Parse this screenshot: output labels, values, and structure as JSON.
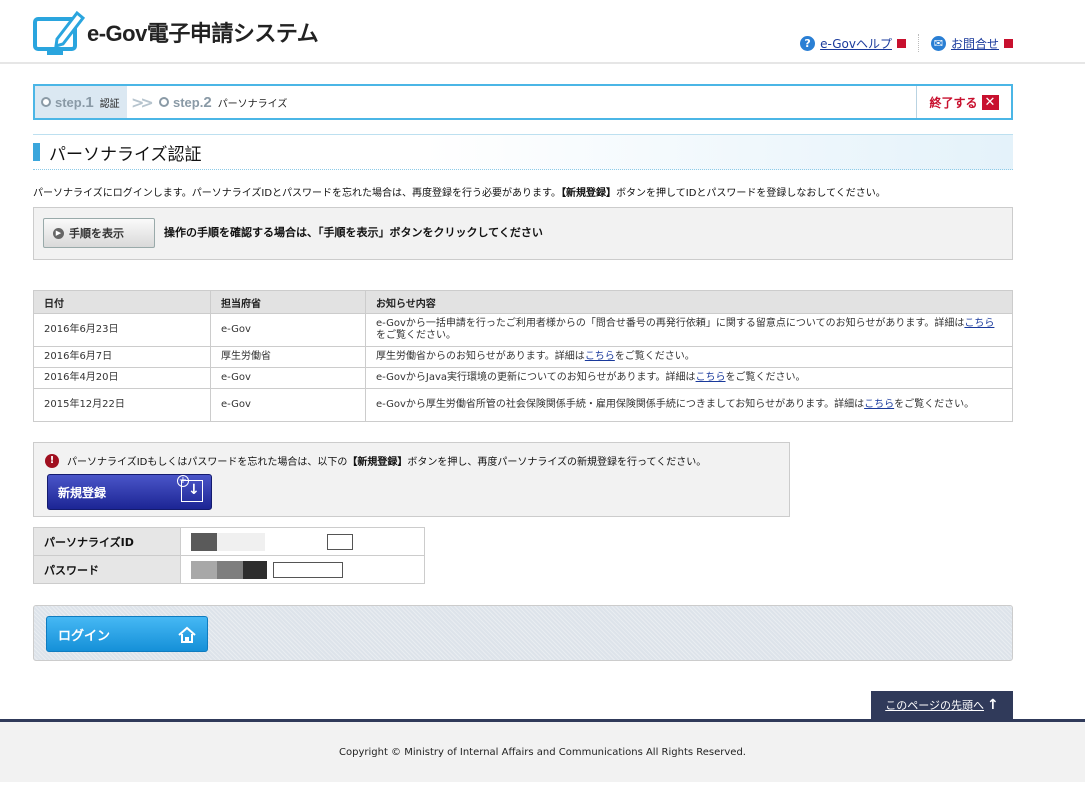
{
  "header": {
    "logo_text": "e-Gov電子申請システム",
    "help_label": "e-Govヘルプ",
    "contact_label": "お問合せ"
  },
  "steps": {
    "step1_prefix": "step.",
    "step1_num": "1",
    "step1_name": "認証",
    "step2_prefix": "step.",
    "step2_num": "2",
    "step2_name": "パーソナライズ",
    "finish_label": "終了する"
  },
  "section": {
    "title": "パーソナライズ認証",
    "intro_before": "パーソナライズにログインします。パーソナライズIDとパスワードを忘れた場合は、再度登録を行う必要があります。",
    "intro_bold": "【新規登録】",
    "intro_after": "ボタンを押してIDとパスワードを登録しなおしてください。"
  },
  "procedure": {
    "button_label": "手順を表示",
    "text": "操作の手順を確認する場合は、「手順を表示」ボタンをクリックしてください"
  },
  "news": {
    "headers": [
      "日付",
      "担当府省",
      "お知らせ内容"
    ],
    "rows": [
      {
        "date": "2016年6月23日",
        "ministry": "e-Gov",
        "before": "e-Govから一括申請を行ったご利用者様からの「問合せ番号の再発行依頼」に関する留意点についてのお知らせがあります。詳細は",
        "link": "こちら",
        "after": "をご覧ください。"
      },
      {
        "date": "2016年6月7日",
        "ministry": "厚生労働省",
        "before": "厚生労働省からのお知らせがあります。詳細は",
        "link": "こちら",
        "after": "をご覧ください。"
      },
      {
        "date": "2016年4月20日",
        "ministry": "e-Gov",
        "before": "e-GovからJava実行環境の更新についてのお知らせがあります。詳細は",
        "link": "こちら",
        "after": "をご覧ください。"
      },
      {
        "date": "2015年12月22日",
        "ministry": "e-Gov",
        "before": "e-Govから厚生労働省所管の社会保険関係手続・雇用保険関係手続につきましてお知らせがあります。詳細は",
        "link": "こちら",
        "after": "をご覧ください。"
      }
    ]
  },
  "notice": {
    "before": "パーソナライズIDもしくはパスワードを忘れた場合は、以下の",
    "bold": "【新規登録】",
    "after": "ボタンを押し、再度パーソナライズの新規登録を行ってください。",
    "new_button_label": "新規登録"
  },
  "login": {
    "id_label": "パーソナライズID",
    "password_label": "パスワード",
    "button_label": "ログイン"
  },
  "pagetop_label": "このページの先頭へ",
  "footer_text": "Copyright © Ministry of Internal Affairs and Communications All Rights Reserved.",
  "colors": {
    "accent_blue": "#3aa6dc",
    "finish_red": "#c8102e",
    "new_button": "#1c2594",
    "login_button": "#1590d8",
    "footer_bar": "#303a5a"
  }
}
